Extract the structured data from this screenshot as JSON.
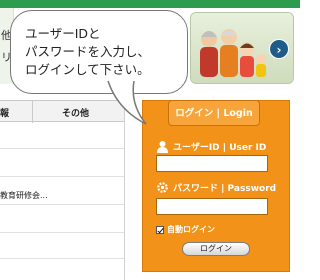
{
  "banner": {
    "left_chars": [
      "他",
      "リ"
    ],
    "next_glyph": "›"
  },
  "bubble": {
    "lines": [
      "ユーザーIDと",
      "パスワードを入力し、",
      "ログインして下さい。"
    ]
  },
  "table": {
    "headers": [
      "報",
      "その他"
    ],
    "rows": [
      "",
      "",
      "教育研修会...",
      ""
    ]
  },
  "login": {
    "title": "ログイン | Login",
    "userid_label": "ユーザーID | User ID",
    "userid_value": "",
    "password_label": "パスワード | Password",
    "password_value": "",
    "auto_login_label": "自動ログイン",
    "auto_login_checked": true,
    "submit_label": "ログイン"
  },
  "colors": {
    "accent_green": "#2e9c4e",
    "login_orange": "#f29218",
    "banner_next": "#1f5c8a"
  },
  "icons": [
    "user-icon",
    "gear-icon",
    "next-arrow-icon"
  ]
}
